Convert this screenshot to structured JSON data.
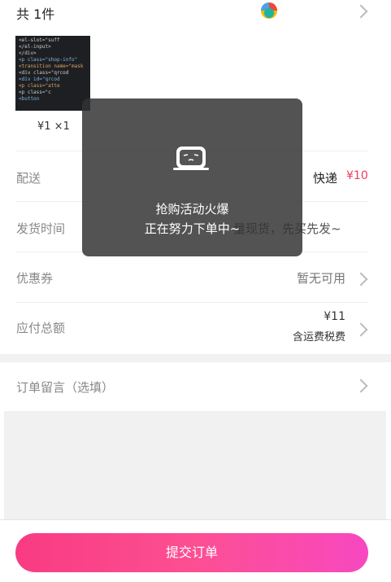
{
  "order": {
    "item_count_label": "共 1件",
    "price_qty": "¥1 ×1"
  },
  "rows": {
    "shipping": {
      "label": "配送",
      "method": "快递",
      "fee": "¥10"
    },
    "delivery_time": {
      "label": "发货时间",
      "value": "量现货，先买先发~"
    },
    "coupon": {
      "label": "优惠券",
      "value": "暂无可用"
    },
    "total": {
      "label": "应付总额",
      "amount": "¥11",
      "note": "含运费税费"
    },
    "remark": {
      "label": "订单留言（选填）"
    }
  },
  "toast": {
    "line1": "抢购活动火爆",
    "line2": "正在努力下单中~"
  },
  "footer": {
    "submit_label": "提交订单"
  },
  "thumb_code": [
    "<el-slot=\"suff",
    "  </el-input>",
    "</div>",
    "<p class=\"shop-info\"",
    "<transition name=\"mask",
    "  <div class=\"qrcod",
    "    <div id=\"qrcod",
    "    <p class=\"atte",
    "    <p class=\"c",
    "    <button"
  ],
  "colors": {
    "accent": "#ee3b5f",
    "button_start": "#f93b82",
    "button_end": "#f848c0",
    "toast_bg": "#323232"
  }
}
